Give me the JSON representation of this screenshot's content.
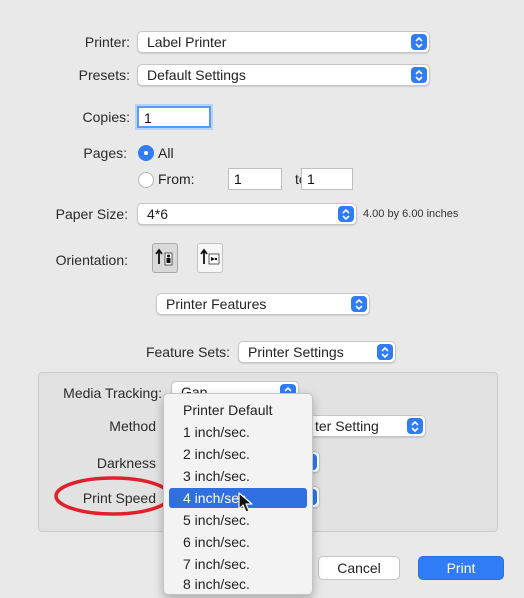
{
  "printer": {
    "label": "Printer:",
    "value": "Label Printer"
  },
  "presets": {
    "label": "Presets:",
    "value": "Default Settings"
  },
  "copies": {
    "label": "Copies:",
    "value": "1"
  },
  "pages": {
    "label": "Pages:",
    "all_label": "All",
    "from_label": "From:",
    "from_value": "1",
    "to_label": "to:",
    "to_value": "1"
  },
  "paper_size": {
    "label": "Paper Size:",
    "value": "4*6",
    "dimensions": "4.00 by 6.00 inches"
  },
  "orientation": {
    "label": "Orientation:",
    "portrait_icon": "portrait-orientation-icon",
    "landscape_icon": "landscape-orientation-icon"
  },
  "section_select": {
    "value": "Printer Features"
  },
  "feature_sets": {
    "label": "Feature Sets:",
    "value": "Printer Settings"
  },
  "features": {
    "media_tracking": {
      "label": "Media Tracking:",
      "value": "Gap"
    },
    "method": {
      "label": "Method",
      "value": "ter Setting"
    },
    "darkness": {
      "label": "Darkness"
    },
    "print_speed": {
      "label": "Print Speed"
    }
  },
  "speed_menu": {
    "items": [
      "Printer Default",
      "1 inch/sec.",
      "2 inch/sec.",
      "3 inch/sec.",
      "4 inch/sec.",
      "5 inch/sec.",
      "6 inch/sec.",
      "7 inch/sec.",
      "8 inch/sec."
    ],
    "highlighted_index": 4
  },
  "buttons": {
    "cancel": "Cancel",
    "print": "Print"
  },
  "colors": {
    "accent": "#2f7cf6",
    "highlight": "#2f6fe0",
    "annotation": "#e0202a"
  }
}
